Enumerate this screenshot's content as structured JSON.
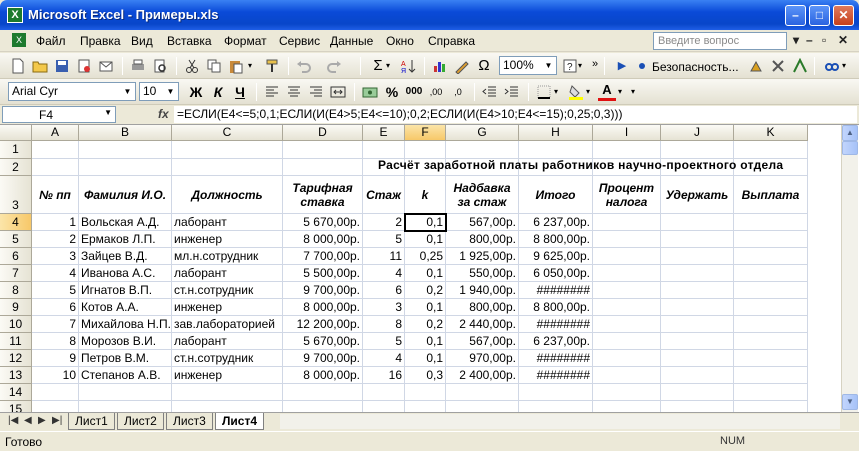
{
  "window": {
    "title": "Microsoft Excel - Примеры.xls"
  },
  "menu": {
    "items": [
      "Файл",
      "Правка",
      "Вид",
      "Вставка",
      "Формат",
      "Сервис",
      "Данные",
      "Окно",
      "Справка"
    ],
    "help_placeholder": "Введите вопрос"
  },
  "toolbar1": {
    "zoom": "100%",
    "security": "Безопасность..."
  },
  "toolbar2": {
    "font": "Arial Cyr",
    "size": "10"
  },
  "formula_bar": {
    "cell": "F4",
    "fx": "fx",
    "formula": "=ЕСЛИ(E4<=5;0,1;ЕСЛИ(И(E4>5;E4<=10);0,2;ЕСЛИ(И(E4>10;E4<=15);0,25;0,3)))"
  },
  "grid": {
    "columns": [
      "A",
      "B",
      "C",
      "D",
      "E",
      "F",
      "G",
      "H",
      "I",
      "J",
      "K"
    ],
    "rows": [
      "1",
      "2",
      "3",
      "4",
      "5",
      "6",
      "7",
      "8",
      "9",
      "10",
      "11",
      "12",
      "13",
      "14",
      "15"
    ],
    "title": "Расчёт заработной платы работников научно-проектного отдела",
    "headers": {
      "A": "№ пп",
      "B": "Фамилия И.О.",
      "C": "Должность",
      "D": "Тарифная ставка",
      "E": "Стаж",
      "F": "k",
      "G": "Надбавка за стаж",
      "H": "Итого",
      "I": "Процент налога",
      "J": "Удержать",
      "K": "Выплата"
    },
    "data": [
      [
        "1",
        "Вольская А.Д.",
        "лаборант",
        "5 670,00р.",
        "2",
        "0,1",
        "567,00р.",
        "6 237,00р."
      ],
      [
        "2",
        "Ермаков Л.П.",
        "инженер",
        "8 000,00р.",
        "5",
        "0,1",
        "800,00р.",
        "8 800,00р."
      ],
      [
        "3",
        "Зайцев В.Д.",
        "мл.н.сотрудник",
        "7 700,00р.",
        "11",
        "0,25",
        "1 925,00р.",
        "9 625,00р."
      ],
      [
        "4",
        "Иванова А.С.",
        "лаборант",
        "5 500,00р.",
        "4",
        "0,1",
        "550,00р.",
        "6 050,00р."
      ],
      [
        "5",
        "Игнатов В.П.",
        "ст.н.сотрудник",
        "9 700,00р.",
        "6",
        "0,2",
        "1 940,00р.",
        "########"
      ],
      [
        "6",
        "Котов А.А.",
        "инженер",
        "8 000,00р.",
        "3",
        "0,1",
        "800,00р.",
        "8 800,00р."
      ],
      [
        "7",
        "Михайлова Н.П.",
        "зав.лабораторией",
        "12 200,00р.",
        "8",
        "0,2",
        "2 440,00р.",
        "########"
      ],
      [
        "8",
        "Морозов В.И.",
        "лаборант",
        "5 670,00р.",
        "5",
        "0,1",
        "567,00р.",
        "6 237,00р."
      ],
      [
        "9",
        "Петров В.М.",
        "ст.н.сотрудник",
        "9 700,00р.",
        "4",
        "0,1",
        "970,00р.",
        "########"
      ],
      [
        "10",
        "Степанов А.В.",
        "инженер",
        "8 000,00р.",
        "16",
        "0,3",
        "2 400,00р.",
        "########"
      ]
    ]
  },
  "sheets": {
    "tabs": [
      "Лист1",
      "Лист2",
      "Лист3",
      "Лист4"
    ],
    "active": "Лист4"
  },
  "status": {
    "text": "Готово",
    "num": "NUM"
  }
}
